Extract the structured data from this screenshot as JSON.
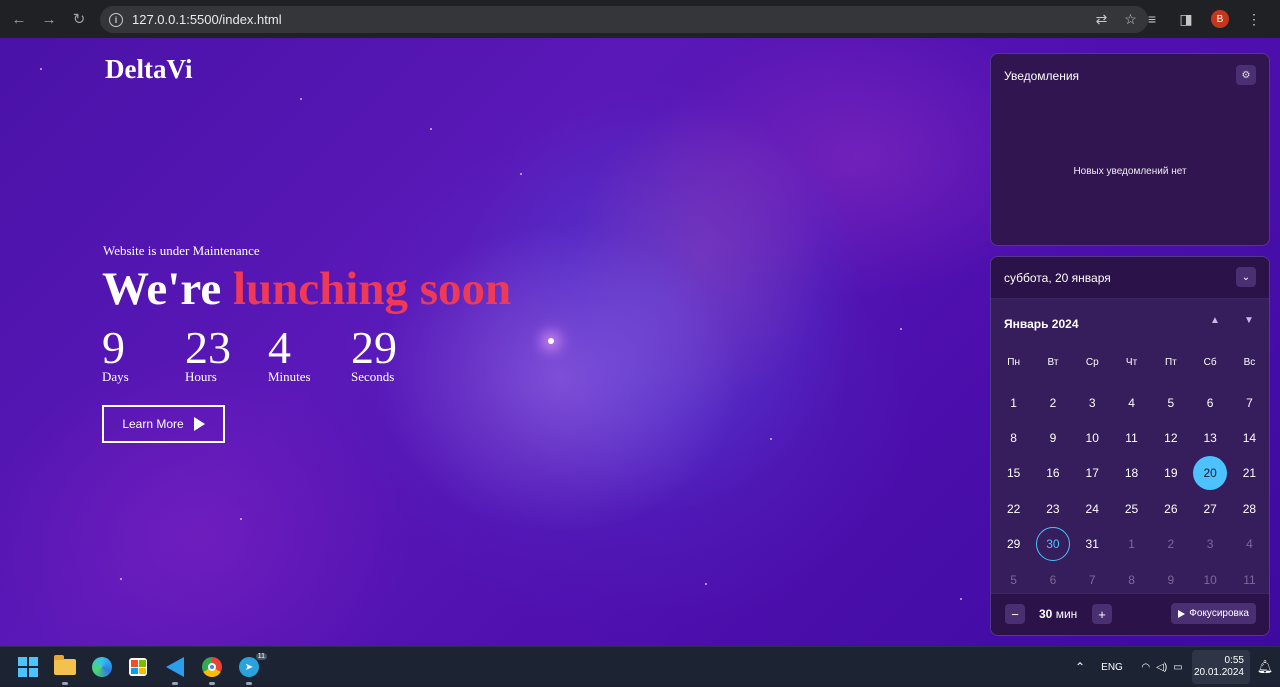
{
  "browser": {
    "url": "127.0.0.1:5500/index.html",
    "profile_initial": "B"
  },
  "site": {
    "logo": "DeltaVi",
    "maintenance_text": "Website is under Maintenance",
    "headline_prefix": "We're",
    "headline_accent": "lunching soon",
    "countdown": [
      {
        "value": "9",
        "label": "Days"
      },
      {
        "value": "23",
        "label": "Hours"
      },
      {
        "value": "4",
        "label": "Minutes"
      },
      {
        "value": "29",
        "label": "Seconds"
      }
    ],
    "cta_label": "Learn More",
    "accent_color": "#ee3a57"
  },
  "notifications": {
    "title": "Уведомления",
    "empty_text": "Новых уведомлений нет"
  },
  "calendar": {
    "date_header": "суббота, 20 января",
    "month_label": "Январь 2024",
    "weekdays": [
      "Пн",
      "Вт",
      "Ср",
      "Чт",
      "Пт",
      "Сб",
      "Вс"
    ],
    "days": [
      {
        "d": "1"
      },
      {
        "d": "2"
      },
      {
        "d": "3"
      },
      {
        "d": "4"
      },
      {
        "d": "5"
      },
      {
        "d": "6"
      },
      {
        "d": "7"
      },
      {
        "d": "8"
      },
      {
        "d": "9"
      },
      {
        "d": "10"
      },
      {
        "d": "11"
      },
      {
        "d": "12"
      },
      {
        "d": "13"
      },
      {
        "d": "14"
      },
      {
        "d": "15"
      },
      {
        "d": "16"
      },
      {
        "d": "17"
      },
      {
        "d": "18"
      },
      {
        "d": "19"
      },
      {
        "d": "20",
        "state": "today"
      },
      {
        "d": "21"
      },
      {
        "d": "22"
      },
      {
        "d": "23"
      },
      {
        "d": "24"
      },
      {
        "d": "25"
      },
      {
        "d": "26"
      },
      {
        "d": "27"
      },
      {
        "d": "28"
      },
      {
        "d": "29"
      },
      {
        "d": "30",
        "state": "marked"
      },
      {
        "d": "31"
      },
      {
        "d": "1",
        "state": "muted"
      },
      {
        "d": "2",
        "state": "muted"
      },
      {
        "d": "3",
        "state": "muted"
      },
      {
        "d": "4",
        "state": "muted"
      },
      {
        "d": "5",
        "state": "muted"
      },
      {
        "d": "6",
        "state": "muted"
      },
      {
        "d": "7",
        "state": "muted"
      },
      {
        "d": "8",
        "state": "muted"
      },
      {
        "d": "9",
        "state": "muted"
      },
      {
        "d": "10",
        "state": "muted"
      },
      {
        "d": "11",
        "state": "muted"
      }
    ],
    "focus_value": "30",
    "focus_unit": "мин",
    "focus_button": "Фокусировка",
    "today_color": "#4cc2ff"
  },
  "taskbar": {
    "apps": [
      "start-icon",
      "file-explorer-icon",
      "edge-icon",
      "store-icon",
      "vscode-icon",
      "chrome-icon",
      "telegram-icon"
    ],
    "telegram_badge": "11",
    "language": "ENG",
    "time": "0:55",
    "date": "20.01.2024"
  }
}
